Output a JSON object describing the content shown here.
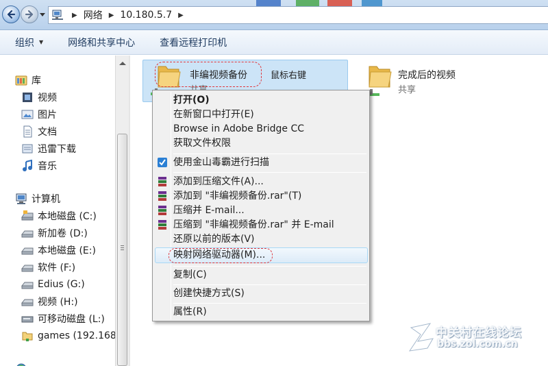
{
  "address": {
    "crumbs": [
      "网络",
      "10.180.5.7"
    ]
  },
  "toolbar": {
    "organize": "组织",
    "network_center": "网络和共享中心",
    "remote_printers": "查看远程打印机"
  },
  "sidebar": {
    "library": "库",
    "video": "视频",
    "pictures": "图片",
    "documents": "文档",
    "xunlei": "迅雷下载",
    "music": "音乐",
    "computer": "计算机",
    "drives": [
      "本地磁盘 (C:)",
      "新加卷 (D:)",
      "本地磁盘 (E:)",
      "软件 (F:)",
      "Edius (G:)",
      "视频 (H:)",
      "可移动磁盘 (L:)",
      "games (192.168."
    ]
  },
  "content": {
    "folder1": {
      "name": "非编视频备份",
      "sub": "共享"
    },
    "annotation": "鼠标右键",
    "folder2": {
      "name": "完成后的视频",
      "sub": "共享"
    }
  },
  "menu": {
    "open": "打开(O)",
    "open_new_window": "在新窗口中打开(E)",
    "bridge": "Browse in Adobe Bridge CC",
    "permissions": "获取文件权限",
    "scan": "使用金山毒霸进行扫描",
    "add_archive": "添加到压缩文件(A)...",
    "add_rar": "添加到 \"非编视频备份.rar\"(T)",
    "compress_email": "压缩并 E-mail...",
    "compress_rar_email": "压缩到 \"非编视频备份.rar\" 并 E-mail",
    "restore": "还原以前的版本(V)",
    "map_drive": "映射网络驱动器(M)...",
    "copy": "复制(C)",
    "shortcut": "创建快捷方式(S)",
    "properties": "属性(R)"
  },
  "watermark": {
    "site": "中关村在线论坛",
    "url": "bbs.zol.com.cn"
  },
  "colors": {
    "annotation_red": "#e0353b",
    "selection": "#cce4f7",
    "menu_hover_border": "#a8d8f6"
  }
}
